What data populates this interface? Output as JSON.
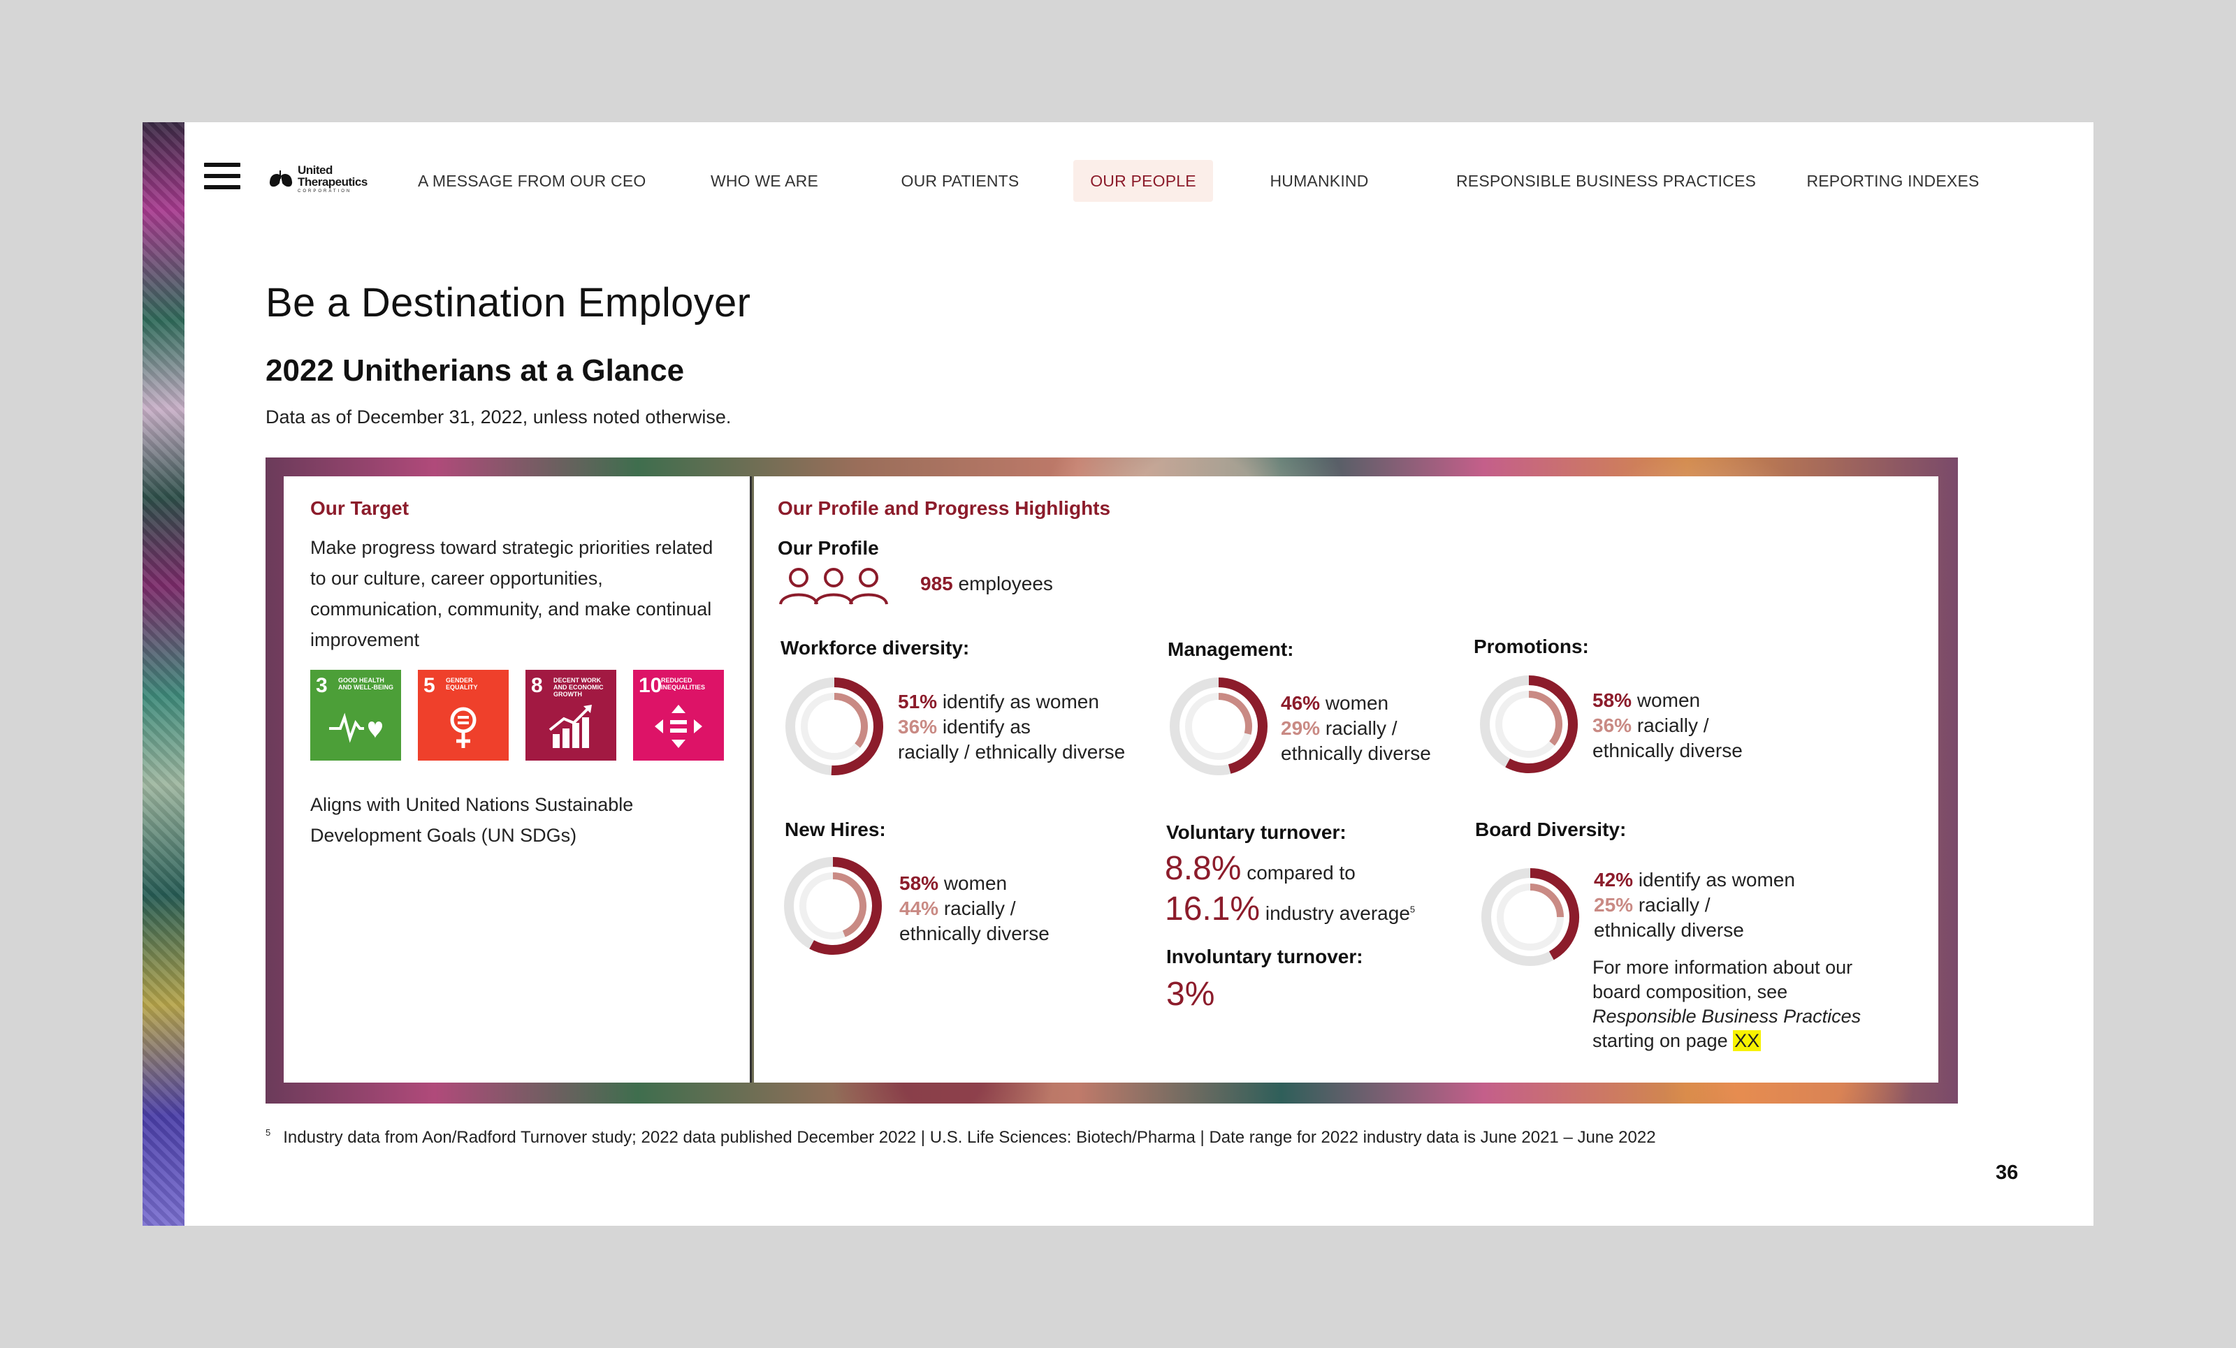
{
  "nav": {
    "items": [
      {
        "label": "A MESSAGE FROM OUR CEO"
      },
      {
        "label": "WHO WE ARE"
      },
      {
        "label": "OUR PATIENTS"
      },
      {
        "label": "OUR PEOPLE"
      },
      {
        "label": "HUMANKIND"
      },
      {
        "label": "RESPONSIBLE BUSINESS PRACTICES"
      },
      {
        "label": "REPORTING INDEXES"
      }
    ],
    "active": "OUR PEOPLE"
  },
  "logo": {
    "line1": "United",
    "line2": "Therapeutics",
    "line3": "CORPORATION"
  },
  "title": "Be a Destination Employer",
  "subtitle": "2022 Unitherians at a Glance",
  "note": "Data as of December 31, 2022, unless noted otherwise.",
  "target": {
    "label": "Our Target",
    "text": "Make progress toward strategic priorities related to our culture, career opportunities, communication, community, and make continual improvement",
    "sdgs": [
      {
        "num": "3",
        "caption": "GOOD HEALTH AND WELL-BEING",
        "color": "#4c9f38"
      },
      {
        "num": "5",
        "caption": "GENDER EQUALITY",
        "color": "#ef402b"
      },
      {
        "num": "8",
        "caption": "DECENT WORK AND ECONOMIC GROWTH",
        "color": "#a21942"
      },
      {
        "num": "10",
        "caption": "REDUCED INEQUALITIES",
        "color": "#dd1367"
      }
    ],
    "aligns": "Aligns with United Nations Sustainable Development Goals (UN SDGs)"
  },
  "profile": {
    "heading": "Our Profile and Progress Highlights",
    "label": "Our Profile",
    "employees_num": "985",
    "employees_text": "employees"
  },
  "workforce": {
    "label": "Workforce diversity:",
    "p1": "51%",
    "t1": "identify as women",
    "p2": "36%",
    "t2": "identify as",
    "t2b": "racially / ethnically diverse",
    "v1": 51,
    "v2": 36
  },
  "management": {
    "label": "Management:",
    "p1": "46%",
    "t1": "women",
    "p2": "29%",
    "t2": "racially /",
    "t2b": "ethnically diverse",
    "v1": 46,
    "v2": 29
  },
  "promotions": {
    "label": "Promotions:",
    "p1": "58%",
    "t1": "women",
    "p2": "36%",
    "t2": "racially /",
    "t2b": "ethnically diverse",
    "v1": 58,
    "v2": 36
  },
  "newhires": {
    "label": "New Hires:",
    "p1": "58%",
    "t1": "women",
    "p2": "44%",
    "t2": "racially /",
    "t2b": "ethnically diverse",
    "v1": 58,
    "v2": 44
  },
  "voluntary": {
    "label": "Voluntary turnover:",
    "p1": "8.8%",
    "t1": "compared to",
    "p2": "16.1%",
    "t2": "industry average",
    "sup": "5"
  },
  "involuntary": {
    "label": "Involuntary turnover:",
    "p1": "3%"
  },
  "board": {
    "label": "Board Diversity:",
    "p1": "42%",
    "t1": "identify as women",
    "p2": "25%",
    "t2": "racially /",
    "t2b": "ethnically diverse",
    "v1": 42,
    "v2": 25,
    "more1": "For more information about our board composition, see",
    "more_italic": "Responsible Business Practices",
    "more2": "starting on page",
    "page_ref": "XX"
  },
  "footnote": {
    "sup": "5",
    "text": "Industry data from Aon/Radford Turnover study; 2022 data published December 2022 | U.S. Life Sciences: Biotech/Pharma | Date range for 2022 industry data is June 2021 – June 2022"
  },
  "page_number": "36",
  "colors": {
    "accent": "#8c1c2b",
    "accent_light": "#c98a84",
    "track": "#e3e3e3",
    "highlight": "#f7f200"
  }
}
